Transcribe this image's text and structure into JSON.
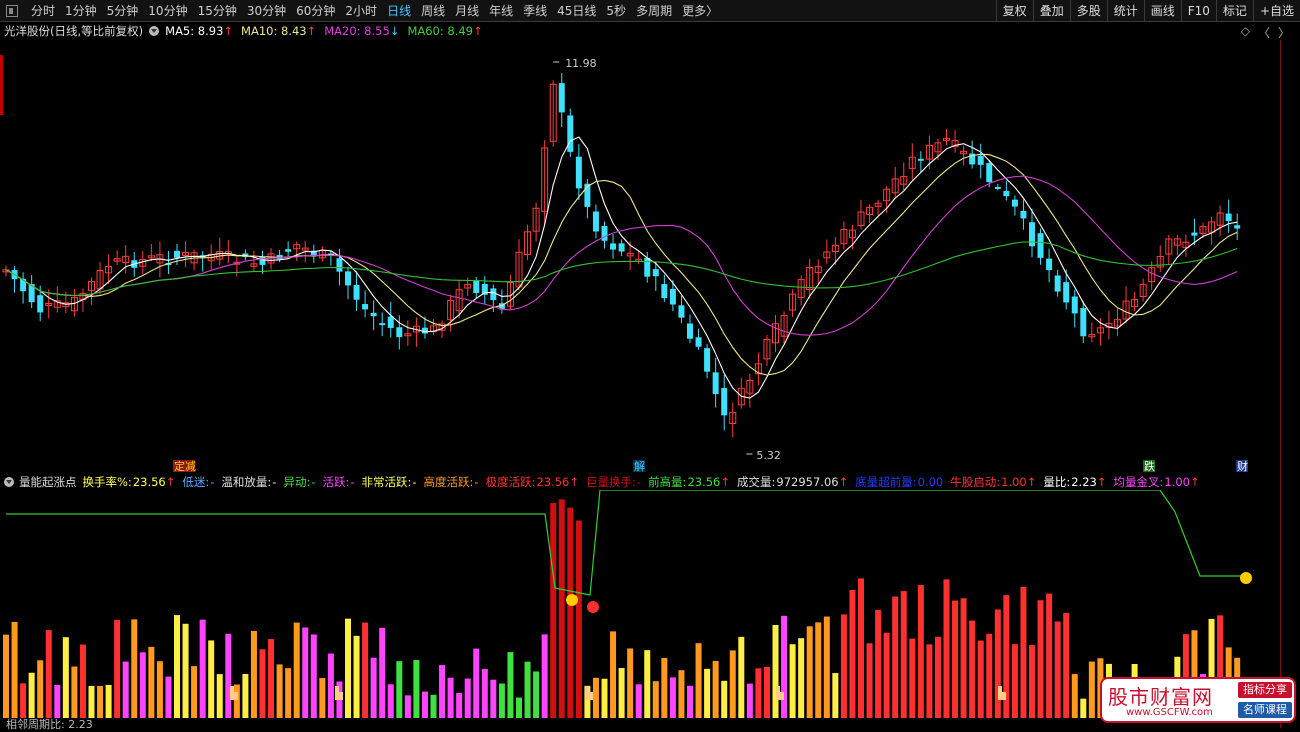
{
  "toolbar": {
    "periods": [
      "分时",
      "1分钟",
      "5分钟",
      "10分钟",
      "15分钟",
      "30分钟",
      "60分钟",
      "2小时",
      "日线",
      "周线",
      "月线",
      "年线",
      "季线",
      "45日线",
      "5秒",
      "多周期",
      "更多〉"
    ],
    "active_period": "日线",
    "tools": [
      "复权",
      "叠加",
      "多股",
      "统计",
      "画线",
      "F10",
      "标记",
      "+自选"
    ]
  },
  "info": {
    "title": "光洋股份(日线,等比前复权)",
    "ma": [
      {
        "label": "MA5: 8.93",
        "arrow": "↑",
        "color": "#ffffff",
        "arrow_color": "#ff3b3b"
      },
      {
        "label": "MA10: 8.43",
        "arrow": "↑",
        "color": "#f0e68c",
        "arrow_color": "#ff3b3b"
      },
      {
        "label": "MA20: 8.55",
        "arrow": "↓",
        "color": "#e040e0",
        "arrow_color": "#3ad0ff"
      },
      {
        "label": "MA60: 8.49",
        "arrow": "↑",
        "color": "#40d040",
        "arrow_color": "#ff3b3b"
      }
    ]
  },
  "annotations": {
    "high": "11.98",
    "low": "5.32"
  },
  "event_tags": [
    {
      "text": "定减",
      "color": "#ffcc00",
      "bg": "#8b1a1a"
    },
    {
      "text": "解",
      "color": "#3ad0ff",
      "bg": "#0a3050"
    },
    {
      "text": "跌",
      "color": "#ffffff",
      "bg": "#1a6a1a"
    },
    {
      "text": "财",
      "color": "#ffffff",
      "bg": "#1a3a8a"
    }
  ],
  "indicator": {
    "name": "量能起涨点",
    "fields": [
      {
        "label": "换手率%:",
        "value": "23.56",
        "arrow": "↑",
        "color": "#ffff55"
      },
      {
        "label": "低迷:",
        "value": "-",
        "arrow": "",
        "color": "#5fa8ff"
      },
      {
        "label": "温和放量:",
        "value": "-",
        "arrow": "",
        "color": "#e0e0e0"
      },
      {
        "label": "异动:",
        "value": "-",
        "arrow": "",
        "color": "#40e040"
      },
      {
        "label": "活跃:",
        "value": "-",
        "arrow": "",
        "color": "#ff44ff"
      },
      {
        "label": "非常活跃:",
        "value": "-",
        "arrow": "",
        "color": "#ffff55"
      },
      {
        "label": "高度活跃:",
        "value": "-",
        "arrow": "",
        "color": "#ff9a1f"
      },
      {
        "label": "极度活跃:",
        "value": "23.56",
        "arrow": "↑",
        "color": "#ff3030"
      },
      {
        "label": "巨量换手:",
        "value": "-",
        "arrow": "",
        "color": "#d01010"
      },
      {
        "label": "前高量:",
        "value": "23.56",
        "arrow": "↑",
        "color": "#40e040"
      },
      {
        "label": "成交量:",
        "value": "972957.06",
        "arrow": "↑",
        "color": "#e0e0e0"
      },
      {
        "label": "底量超前量:",
        "value": "0.00",
        "arrow": "",
        "color": "#1e3cff"
      },
      {
        "label": "牛股启动:",
        "value": "1.00",
        "arrow": "↑",
        "color": "#ff3030"
      },
      {
        "label": "量比:",
        "value": "2.23",
        "arrow": "↑",
        "color": "#ffffff"
      },
      {
        "label": "均量金叉:",
        "value": "1.00",
        "arrow": "↑",
        "color": "#ff44ff"
      }
    ]
  },
  "bottom_label": "相邻周期比: 2.23",
  "right_icons": [
    "◇",
    "〈",
    "〉"
  ],
  "watermark": {
    "title": "股市财富网",
    "url": "www.GSCFW.com",
    "badge1": "指标分享",
    "badge2": "名师课程"
  }
}
